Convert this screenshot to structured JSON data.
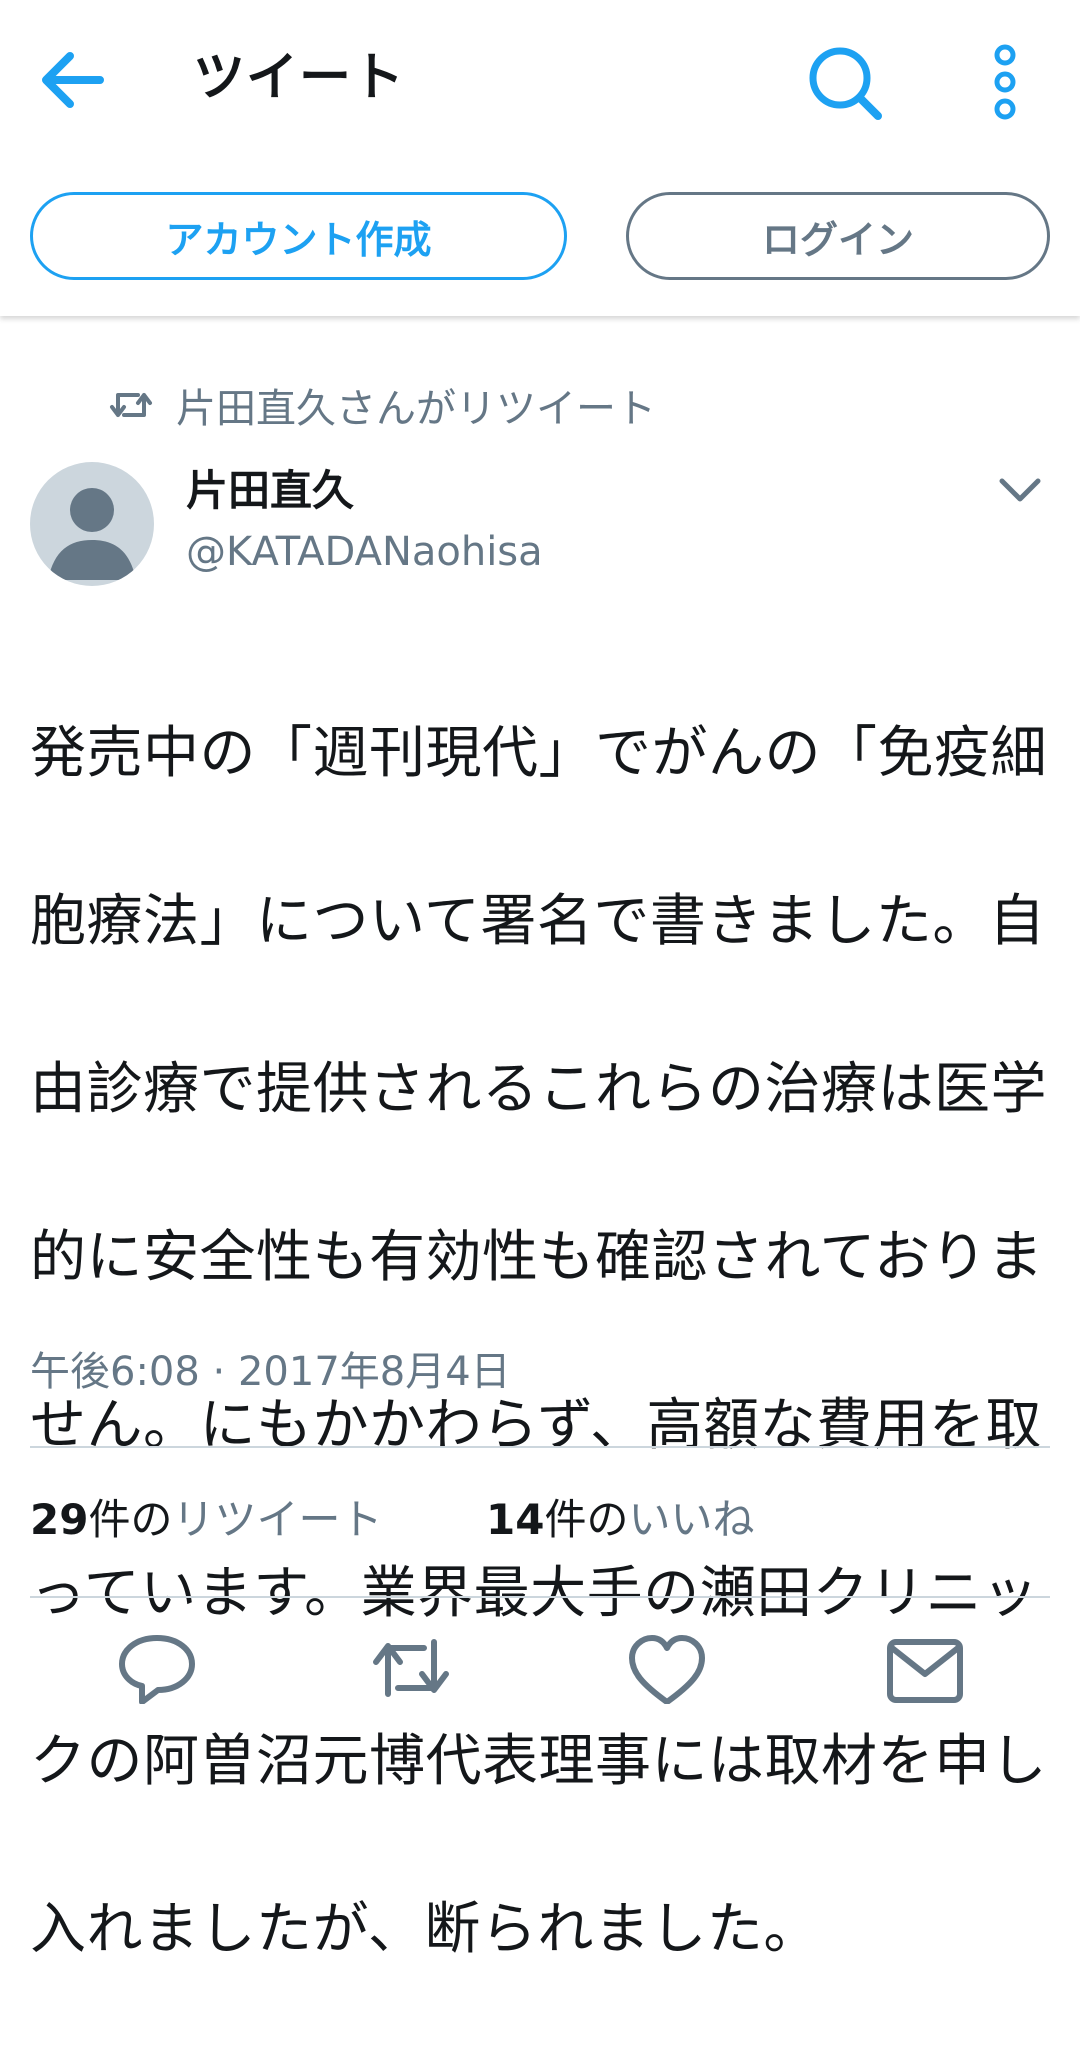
{
  "header": {
    "title": "ツイート",
    "back_icon": "arrow-left-icon",
    "search_icon": "search-icon",
    "more_icon": "more-vertical-icon",
    "accent_color": "#1da1f2"
  },
  "auth": {
    "signup_label": "アカウント作成",
    "login_label": "ログイン"
  },
  "tweet": {
    "retweet_context": "片田直久さんがリツイート",
    "author_name": "片田直久",
    "author_handle": "@KATADANaohisa",
    "text_lines": [
      "発売中の「週刊現代」でがんの「免疫細",
      "胞療法」について署名で書きました。自",
      "由診療で提供されるこれらの治療は医学",
      "的に安全性も有効性も確認されておりま",
      "せん。にもかかわらず、高額な費用を取",
      "っています。業界最大手の瀬田クリニッ",
      "クの阿曽沼元博代表理事には取材を申し",
      "入れましたが、断られました。"
    ],
    "timestamp": "午後6:08 · 2017年8月4日",
    "stats": {
      "retweet_count": "29",
      "retweet_unit": "件の",
      "retweet_label": "リツイート",
      "like_count": "14",
      "like_unit": "件の",
      "like_label": "いいね"
    }
  },
  "actions": {
    "reply_icon": "reply-icon",
    "retweet_icon": "retweet-icon",
    "like_icon": "heart-icon",
    "dm_icon": "envelope-icon"
  }
}
